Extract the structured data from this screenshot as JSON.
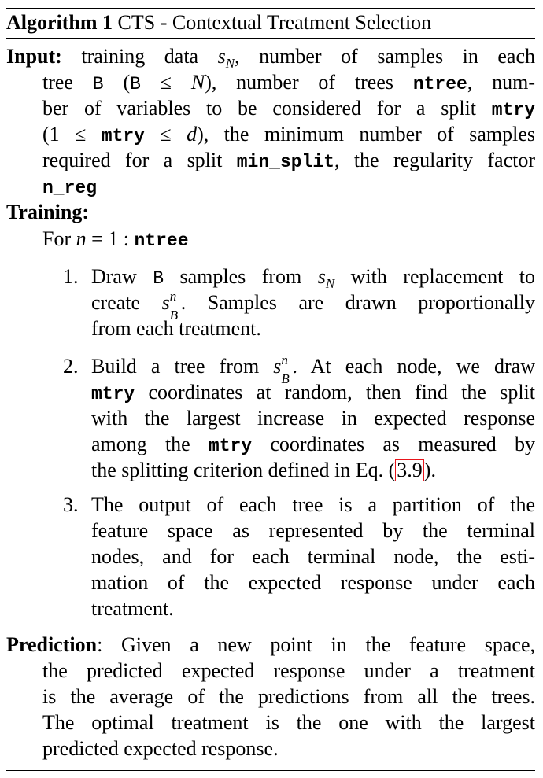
{
  "title_prefix": "Algorithm 1",
  "title_text": "CTS - Contextual Treatment Selection",
  "input_label": "Input:",
  "input": {
    "l1a": "training data",
    "l1b": "s",
    "l1c": "N",
    "l1d": ", number of samples in each",
    "l2a": "tree",
    "l2b": "B",
    "l2c": "(",
    "l2d": "B",
    "l2e": "≤",
    "l2f": "N",
    "l2g": "), number of trees",
    "l2h": "ntree",
    "l2i": ", num-",
    "l3a": "ber of variables to be considered for a split",
    "l3b": "mtry",
    "l4a": "(1 ≤",
    "l4b": "mtry",
    "l4c": "≤",
    "l4d": "d",
    "l4e": "), the minimum number of samples",
    "l5a": "required for a split",
    "l5b": "min_split",
    "l5c": ", the regularity factor",
    "l6a": "n_reg"
  },
  "training_label": "Training:",
  "for_line": {
    "a": "For",
    "b": "n",
    "c": "= 1 :",
    "d": "ntree"
  },
  "steps": [
    {
      "num": "1."
    },
    {
      "num": "2."
    },
    {
      "num": "3."
    }
  ],
  "step1": {
    "l1a": "Draw",
    "l1b": "B",
    "l1c": "samples from",
    "l1d": "s",
    "l1e": "N",
    "l1f": "with replacement to",
    "l2a": "create",
    "l2b": "s",
    "l2c": "n",
    "l2d": "B",
    "l2e": ". Samples are drawn proportionally",
    "l3": "from each treatment."
  },
  "step2": {
    "l1a": "Build a tree from",
    "l1b": "s",
    "l1c": "n",
    "l1d": "B",
    "l1e": ". At each node, we draw",
    "l2a": "mtry",
    "l2b": "coordinates at random, then find the split",
    "l3": "with the largest increase in expected response",
    "l4a": "among the",
    "l4b": "mtry",
    "l4c": "coordinates as measured by",
    "l5a": "the splitting criterion defined in Eq. (",
    "l5b": "3.9",
    "l5c": ")."
  },
  "step3": {
    "l1": "The output of each tree is a partition of the",
    "l2": "feature space as represented by the terminal",
    "l3": "nodes, and for each terminal node, the esti-",
    "l4": "mation of the expected response under each",
    "l5": "treatment."
  },
  "prediction_label": "Prediction",
  "prediction": {
    "l1": ": Given a new point in the feature space,",
    "l2": "the predicted expected response under a treatment",
    "l3": "is the average of the predictions from all the trees.",
    "l4": "The optimal treatment is the one with the largest",
    "l5": "predicted expected response."
  }
}
